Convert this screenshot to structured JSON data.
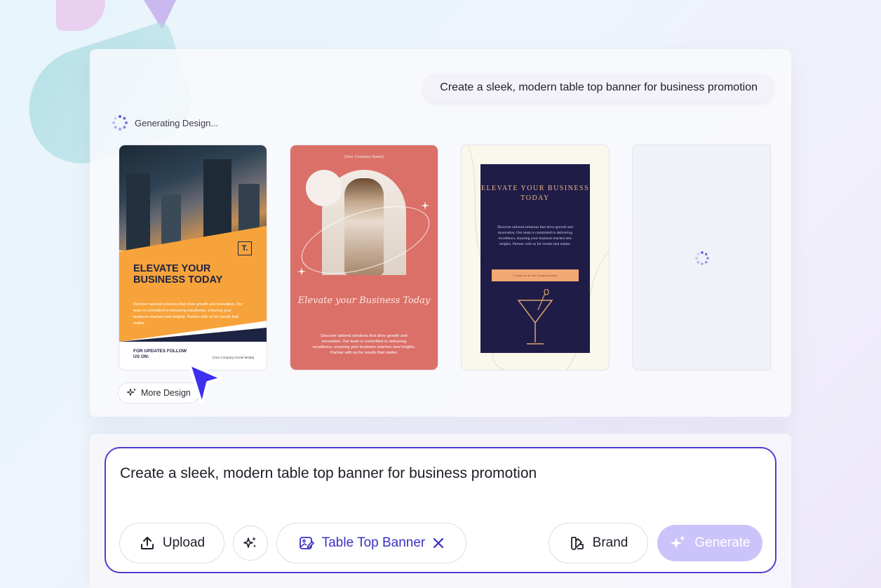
{
  "prompt_bubble": "Create a sleek, modern table top banner for business promotion",
  "status": {
    "text": "Generating Design..."
  },
  "cards": {
    "card1": {
      "title": "ELEVATE YOUR BUSINESS TODAY",
      "body": "Discover tailored solutions that drive growth and innovation. Our team is committed to delivering excellence, ensuring your business reaches new heights. Partner with us for results that matter.",
      "follow": "FOR UPDATES FOLLOW US ON:",
      "social": "[Your Company Social Media]",
      "logo": "T."
    },
    "card2": {
      "company": "[Your Company Name]",
      "title": "Elevate your Business Today",
      "body": "Discover tailored solutions that drive growth and innovation. Our team is committed to delivering excellence, ensuring your business reaches new heights. Partner with us for results that matter."
    },
    "card3": {
      "title": "ELEVATE YOUR BUSINESS TODAY",
      "body": "Discover tailored solutions that drive growth and innovation. Our team is committed to delivering excellence, ensuring your business reaches new heights. Partner with us for results that matter.",
      "button": "Contact us at Your Company Name"
    }
  },
  "more_designs": {
    "label": "More Design"
  },
  "composer": {
    "text": "Create a sleek, modern table top banner for business promotion",
    "upload_label": "Upload",
    "type_label": "Table Top Banner",
    "brand_label": "Brand",
    "generate_label": "Generate"
  },
  "colors": {
    "accent": "#4e3fd0",
    "generate_disabled": "#cbc4fb"
  }
}
